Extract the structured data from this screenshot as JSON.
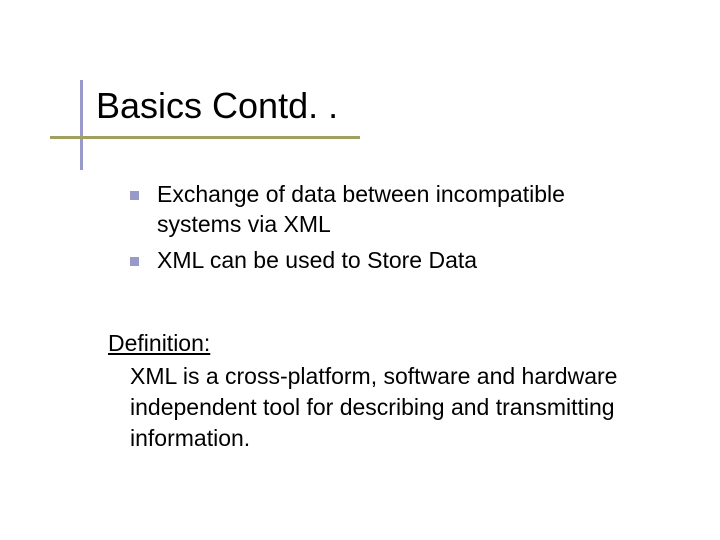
{
  "slide": {
    "title": "Basics Contd. .",
    "bullets": [
      "Exchange of data between incompatible systems via XML",
      "XML can be used to Store Data"
    ],
    "definition_label": "Definition:",
    "definition_text": "XML is a cross-platform, software and hardware independent tool for describing and transmitting information."
  }
}
